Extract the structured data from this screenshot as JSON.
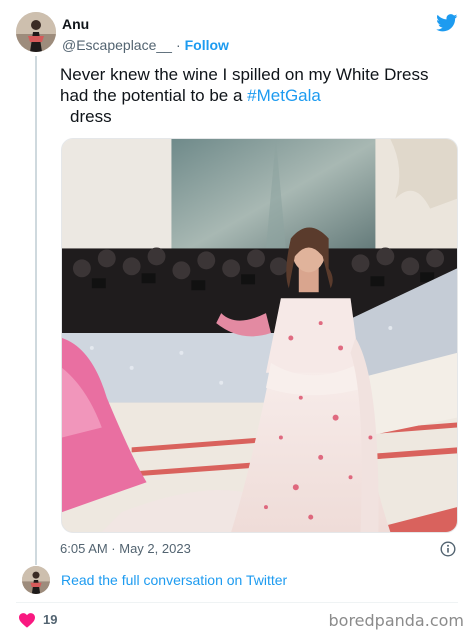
{
  "author": {
    "name": "Anu",
    "handle": "@Escapeplace__",
    "separator": "·",
    "follow_label": "Follow",
    "avatar_icon": "user-avatar"
  },
  "tweet": {
    "text_before_hashtag": "Never knew the wine I spilled on my White Dress had the potential to be a ",
    "hashtag": "#MetGala",
    "text_after_hashtag": "dress",
    "timestamp": "6:05 AM · May 2, 2023"
  },
  "media": {
    "icon": "photo-woman-in-white-dress-at-met-gala"
  },
  "footer": {
    "read_link": "Read the full conversation on Twitter",
    "like_count": "19"
  },
  "watermark": "boredpanda.com",
  "colors": {
    "accent": "#1d9bf0",
    "heart": "#f91880",
    "text": "#0f1419",
    "muted": "#536471"
  }
}
